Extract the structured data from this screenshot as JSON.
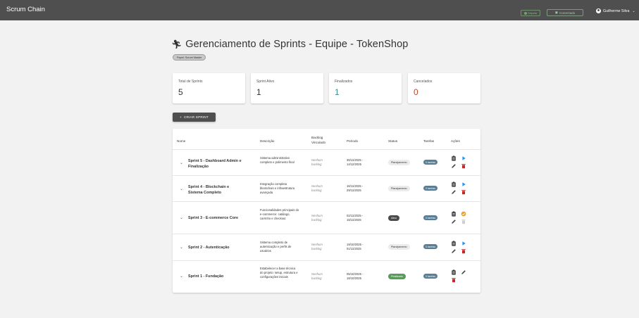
{
  "app": {
    "brand": "Scrum Chain",
    "network_label": "Sepolia",
    "wallet_label": "Conectado",
    "user_name": "Guilherme Silva"
  },
  "page": {
    "title": "Gerenciamento de Sprints - Equipe - TokenShop",
    "role_chip": "Papel: Scrum Master"
  },
  "stats": [
    {
      "label": "Total de Sprints",
      "value": "5"
    },
    {
      "label": "Sprint Ativo",
      "value": "1"
    },
    {
      "label": "Finalizados",
      "value": "1"
    },
    {
      "label": "Cancelados",
      "value": "0"
    }
  ],
  "create_button": "CRIAR SPRINT",
  "table": {
    "headers": {
      "name": "Nome",
      "description": "Descrição",
      "backlog": "Backlog Vinculado",
      "period": "Período",
      "status": "Status",
      "tasks": "Tarefas",
      "actions": "Ações"
    },
    "rows": [
      {
        "name": "Sprint 5 - Dashboard Admin e Finalização",
        "description": "Sistema administrativo completo e polimento final",
        "backlog": "Nenhum backlog",
        "period": "30/11/2025 - 14/12/2025",
        "status": "Planejamento",
        "tasks": "0 tarefas"
      },
      {
        "name": "Sprint 4 - Blockchain e Sistema Completo",
        "description": "Integração completa blockchain e infraestrutura avançada",
        "backlog": "Nenhum backlog",
        "period": "16/11/2025 - 29/11/2025",
        "status": "Planejamento",
        "tasks": "0 tarefas"
      },
      {
        "name": "Sprint 3 - E-commerce Core",
        "description": "Funcionalidades principais do e-commerce: catálogo, carrinho e checkout",
        "backlog": "Nenhum backlog",
        "period": "02/11/2025 - 15/11/2025",
        "status": "Ativo",
        "tasks": "0 tarefas"
      },
      {
        "name": "Sprint 2 - Autenticação",
        "description": "Sistema completo de autenticação e perfis de usuários",
        "backlog": "Nenhum backlog",
        "period": "19/10/2025 - 01/11/2025",
        "status": "Planejamento",
        "tasks": "0 tarefas"
      },
      {
        "name": "Sprint 1 - Fundação",
        "description": "Estabelecer a base técnica do projeto: setup, estrutura e configurações iniciais",
        "backlog": "Nenhum backlog",
        "period": "05/10/2025 - 18/10/2025",
        "status": "Finalizado",
        "tasks": "0 tarefas"
      }
    ]
  },
  "colors": {
    "topbar": "#4f4f4f",
    "teal": "#3e8c8c",
    "red": "#b8482e",
    "tasks_badge": "#5a7d96",
    "finalizado": "#5c9a5c",
    "delete_icon": "#c62828",
    "play_icon": "#2196f3",
    "check_icon": "#f0a020"
  },
  "icons": {
    "title": "running-person-icon",
    "user": "account-circle-icon",
    "wallet": "wallet-icon",
    "row_actions": [
      "clipboard-icon",
      "play-icon",
      "edit-icon",
      "delete-icon",
      "check-circle-icon"
    ]
  }
}
